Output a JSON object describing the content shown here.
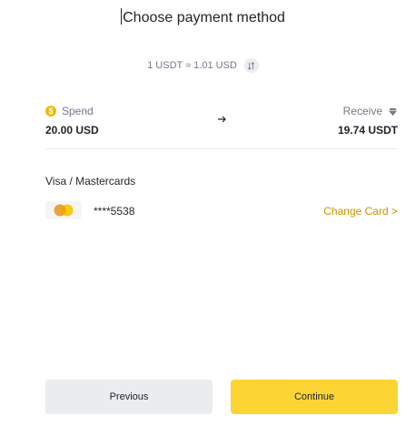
{
  "header": {
    "title": "Choose payment method"
  },
  "rate": {
    "text": "1 USDT ≈ 1.01 USD"
  },
  "exchange": {
    "spend_label": "Spend",
    "spend_amount": "20.00 USD",
    "receive_label": "Receive",
    "receive_amount": "19.74 USDT"
  },
  "payment": {
    "section_title": "Visa / Mastercards",
    "card_number": "****5538",
    "change_card_label": "Change Card >"
  },
  "footer": {
    "previous_label": "Previous",
    "continue_label": "Continue"
  },
  "colors": {
    "accent_yellow": "#fcd535",
    "link_gold": "#c99400",
    "secondary_button": "#eaecef",
    "muted_text": "#707a8a",
    "primary_text": "#1e2329"
  },
  "icons": {
    "spend": "usd-coin-icon",
    "arrow": "arrow-right-icon",
    "receive": "usdt-diamond-icon",
    "swap": "swap-vertical-icon",
    "card": "mastercard-logo-icon"
  }
}
